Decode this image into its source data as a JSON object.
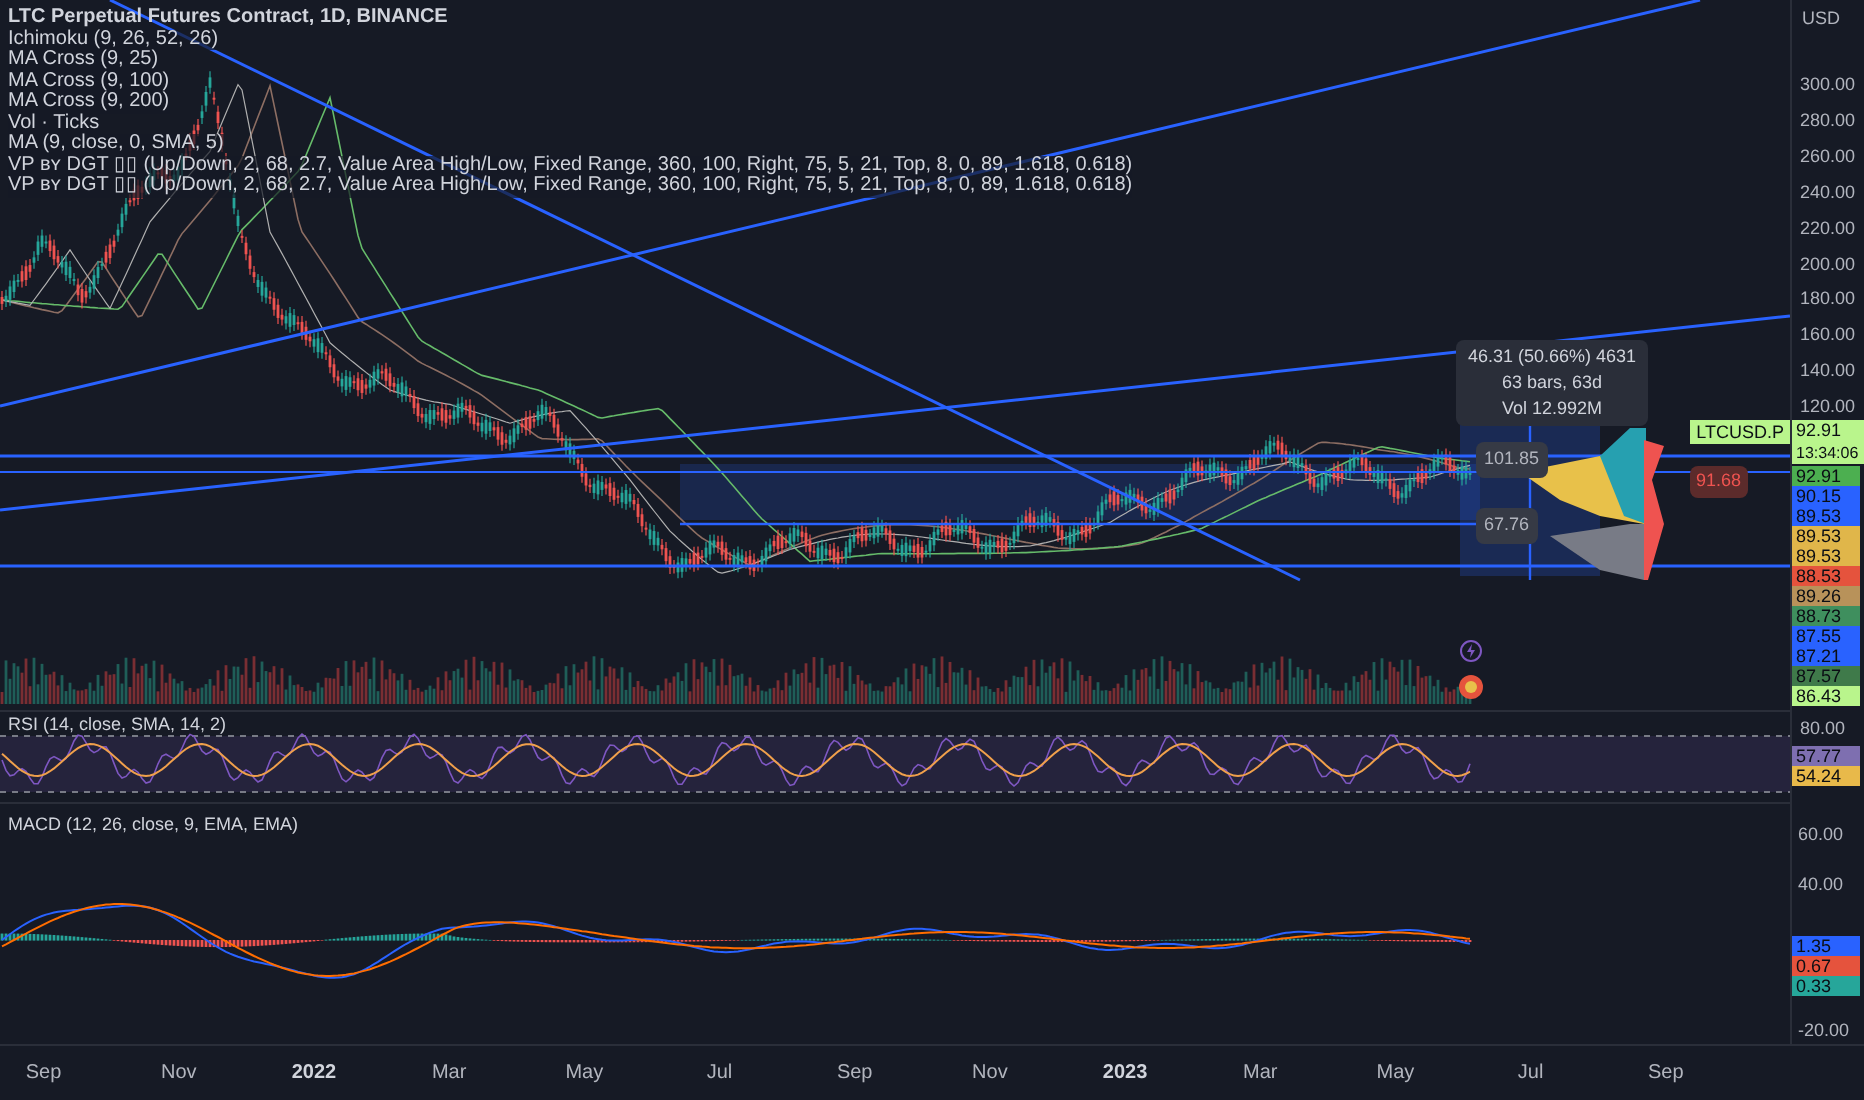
{
  "legend": {
    "title": "LTC Perpetual Futures Contract, 1D, BINANCE",
    "indicators": [
      "Ichimoku (9, 26, 52, 26)",
      "MA Cross (9, 25)",
      "MA Cross (9, 100)",
      "MA Cross (9, 200)",
      "Vol · Ticks",
      "MA (9, close, 0, SMA, 5)",
      "VP ʙʏ DGT ▯▯ (Up/Down, 2, 68, 2.7, Value Area High/Low, Fixed Range, 360, 100, Right, 75, 5, 21, Top, 8, 0, 89, 1.618, 0.618)",
      "VP ʙʏ DGT ▯▯ (Up/Down, 2, 68, 2.7, Value Area High/Low, Fixed Range, 360, 100, Right, 75, 5, 21, Top, 8, 0, 89, 1.618, 0.618)"
    ]
  },
  "measure": {
    "change": "46.31 (50.66%) 4631",
    "bars": "63 bars, 63d",
    "volume": "Vol 12.992M"
  },
  "chart_labels": [
    "101.85",
    "67.76"
  ],
  "alert_label": "91.68",
  "price_axis": {
    "unit": "USD",
    "ticks": [
      "300.00",
      "280.00",
      "260.00",
      "240.00",
      "220.00",
      "200.00",
      "180.00",
      "160.00",
      "140.00",
      "120.00"
    ]
  },
  "symbol_tag": {
    "symbol": "LTCUSD.P",
    "price": "92.91",
    "countdown": "13:34:06"
  },
  "price_tags": [
    {
      "text": "92.91",
      "color": "#4caf50"
    },
    {
      "text": "90.15",
      "color": "#2962ff"
    },
    {
      "text": "89.53",
      "color": "#2962ff"
    },
    {
      "text": "89.53",
      "color": "#e0b64a"
    },
    {
      "text": "89.53",
      "color": "#e0b64a"
    },
    {
      "text": "88.53",
      "color": "#e5533d"
    },
    {
      "text": "89.26",
      "color": "#b8925a"
    },
    {
      "text": "88.73",
      "color": "#3f8f5e"
    },
    {
      "text": "87.55",
      "color": "#2962ff"
    },
    {
      "text": "87.21",
      "color": "#2962ff"
    },
    {
      "text": "87.57",
      "color": "#3f7a4a"
    },
    {
      "text": "86.43",
      "color": "#b9f58c"
    }
  ],
  "rsi": {
    "title": "RSI (14, close, SMA, 14, 2)",
    "ticks": [
      "80.00"
    ],
    "tags": [
      {
        "text": "57.77",
        "color": "#7e6fb0"
      },
      {
        "text": "54.24",
        "color": "#e8b94a"
      }
    ]
  },
  "macd": {
    "title": "MACD (12, 26, close, 9, EMA, EMA)",
    "ticks": [
      "60.00",
      "40.00",
      "-20.00"
    ],
    "tags": [
      {
        "text": "1.35",
        "color": "#2962ff"
      },
      {
        "text": "0.67",
        "color": "#e5533d"
      },
      {
        "text": "0.33",
        "color": "#26a69a"
      }
    ]
  },
  "time_axis": [
    {
      "label": "Sep",
      "bold": false
    },
    {
      "label": "Nov",
      "bold": false
    },
    {
      "label": "2022",
      "bold": true
    },
    {
      "label": "Mar",
      "bold": false
    },
    {
      "label": "May",
      "bold": false
    },
    {
      "label": "Jul",
      "bold": false
    },
    {
      "label": "Sep",
      "bold": false
    },
    {
      "label": "Nov",
      "bold": false
    },
    {
      "label": "2023",
      "bold": true
    },
    {
      "label": "Mar",
      "bold": false
    },
    {
      "label": "May",
      "bold": false
    },
    {
      "label": "Jul",
      "bold": false
    },
    {
      "label": "Sep",
      "bold": false
    }
  ]
}
